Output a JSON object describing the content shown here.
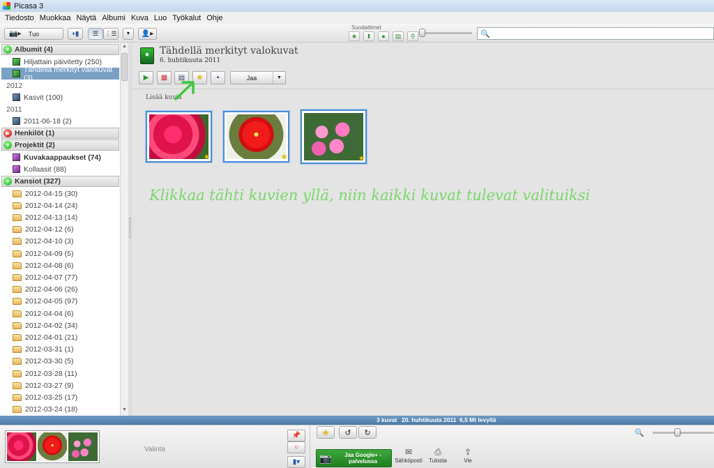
{
  "window": {
    "title": "Picasa 3"
  },
  "menu": [
    "Tiedosto",
    "Muokkaa",
    "Näytä",
    "Albumi",
    "Kuva",
    "Luo",
    "Työkalut",
    "Ohje"
  ],
  "toolbar": {
    "import_label": "Tuo",
    "filters_label": "Suodattimet",
    "filter_icons": [
      "star-filter-icon",
      "upload-filter-icon",
      "person-filter-icon",
      "movie-filter-icon",
      "geotag-filter-icon"
    ],
    "search_placeholder": ""
  },
  "sidebar": {
    "albums_header": "Albumit (4)",
    "albums": [
      {
        "label": "Hiljattain päivitetty (250)"
      },
      {
        "label": "Tähdellä merkityt valokuvat (3)",
        "selected": true
      }
    ],
    "year_2012": "2012",
    "album_2012": "Kasvit (100)",
    "year_2011": "2011",
    "album_2011": "2011-06-18 (2)",
    "people_header": "Henkilöt (1)",
    "projects_header": "Projektit (2)",
    "projects": [
      "Kuvakaappaukset (74)",
      "Kollaasit (88)"
    ],
    "folders_header": "Kansiot (327)",
    "folders": [
      "2012-04-15 (30)",
      "2012-04-14 (24)",
      "2012-04-13 (14)",
      "2012-04-12 (6)",
      "2012-04-10 (3)",
      "2012-04-09 (5)",
      "2012-04-08 (6)",
      "2012-04-07 (77)",
      "2012-04-06 (26)",
      "2012-04-05 (97)",
      "2012-04-04 (6)",
      "2012-04-02 (34)",
      "2012-04-01 (21)",
      "2012-03-31 (1)",
      "2012-03-30 (5)",
      "2012-03-28 (11)",
      "2012-03-27 (9)",
      "2012-03-25 (17)",
      "2012-03-24 (18)"
    ]
  },
  "album": {
    "title": "Tähdellä merkityt valokuvat",
    "date": "6. huhtikuuta 2011",
    "share_label": "Jaa",
    "add_photos_label": "Lisää kuvia"
  },
  "annotation": "Klikkaa tähti kuvien yllä, niin kaikki kuvat tulevat valituiksi",
  "status": {
    "count": "3 kuvat",
    "date": "20. huhtikuuta 2011",
    "disk": "6,5 Mt levyllä"
  },
  "tray": {
    "selection_label": "Valinta",
    "gplus_label": "Jaa Google+ -palvelussa",
    "email_label": "Sähköposti",
    "print_label": "Tulosta",
    "export_label": "Vie"
  },
  "colors": {
    "selection": "#7aa0c4",
    "statusbar": "#4b7aa8",
    "annotation": "#7bd66a",
    "photo_border": "#4c8ed6",
    "gplus": "#2a8f2a"
  }
}
